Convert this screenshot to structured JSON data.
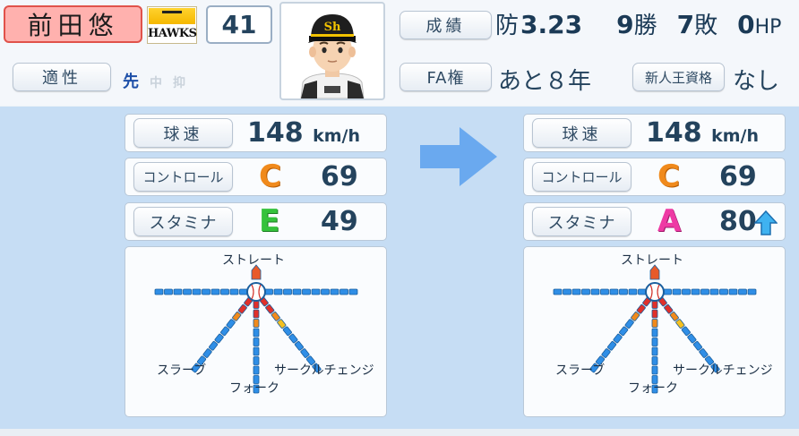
{
  "player": {
    "name": "前田悠",
    "team_logo_top": "SoftBank",
    "team_logo_text": "HAWKS",
    "uniform_number": "41",
    "aptitude_label": "適性",
    "positions": {
      "main": "先",
      "sub1": "中",
      "sub2": "抑"
    }
  },
  "record": {
    "label": "成績",
    "era_prefix": "防",
    "era": "3.23",
    "wins": "9",
    "wins_suffix": "勝",
    "losses": "7",
    "losses_suffix": "敗",
    "holds": "0",
    "holds_suffix": "HP"
  },
  "fa": {
    "label": "FA権",
    "value": "あと８年"
  },
  "rookie": {
    "label": "新人王資格",
    "value": "なし"
  },
  "before": {
    "speed_label": "球速",
    "speed": "148",
    "speed_unit": "km/h",
    "control_label": "コントロール",
    "control_grade": "C",
    "control": "69",
    "stamina_label": "スタミナ",
    "stamina_grade": "E",
    "stamina": "49"
  },
  "after": {
    "speed_label": "球速",
    "speed": "148",
    "speed_unit": "km/h",
    "control_label": "コントロール",
    "control_grade": "C",
    "control": "69",
    "stamina_label": "スタミナ",
    "stamina_grade": "A",
    "stamina": "80",
    "stamina_trend_icon": "up-arrow-icon"
  },
  "pitches": {
    "straight": "ストレート",
    "slider": "スラーブ",
    "fork": "フォーク",
    "circle_change": "サークルチェンジ",
    "levels": {
      "slider": 3,
      "fork": 3,
      "circle_change": 4
    }
  },
  "colors": {
    "name_bg": "#ffb1ae",
    "panel_bg": "#c6ddf4",
    "bar_blue": "#2f8ee6",
    "bar_red": "#e0302a",
    "bar_orange": "#f08a1c",
    "arrow_blue": "#6aa9ef"
  }
}
